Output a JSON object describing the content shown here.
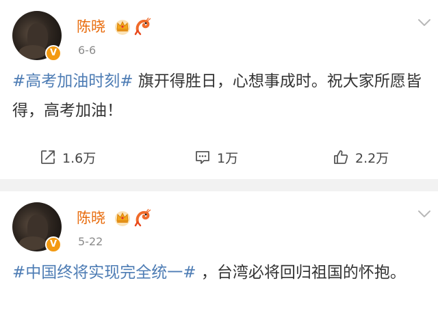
{
  "posts": [
    {
      "username": "陈晓",
      "date": "6-6",
      "verified_mark": "V",
      "hashtag": "#高考加油时刻#",
      "text": " 旗开得胜日，心想事成时。祝大家所愿皆得，高考加油！",
      "repost_count": "1.6万",
      "comment_count": "1万",
      "like_count": "2.2万"
    },
    {
      "username": "陈晓",
      "date": "5-22",
      "verified_mark": "V",
      "hashtag": "#中国终将实现完全统一#",
      "text": " ，台湾必将回归祖国的怀抱。"
    }
  ],
  "icons": {
    "crown": "crown-icon",
    "shrimp": "shrimp-icon",
    "repost": "repost-icon",
    "comment": "comment-icon",
    "like": "like-icon",
    "more": "chevron-down-icon"
  },
  "colors": {
    "username": "#e86b0c",
    "hashtag": "#4d7cb4",
    "verified_badge": "#f39a12",
    "separator": "#f2f2f2"
  }
}
